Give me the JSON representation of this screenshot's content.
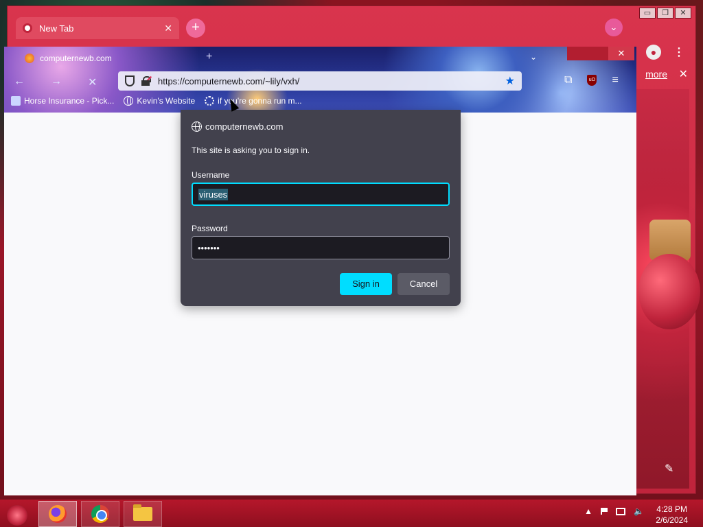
{
  "chrome": {
    "tab_title": "New Tab",
    "link_more": "more"
  },
  "firefox": {
    "tab_title": "computernewb.com",
    "url": "https://computernewb.com/~lily/vxh/",
    "bookmarks": [
      {
        "label": "Horse Insurance - Pick..."
      },
      {
        "label": "Kevin's Website"
      },
      {
        "label": "if you're gonna run m..."
      }
    ]
  },
  "dialog": {
    "site": "computernewb.com",
    "message": "This site is asking you to sign in.",
    "username_label": "Username",
    "username_value": "viruses",
    "password_label": "Password",
    "password_masked": "•••••••",
    "signin_label": "Sign in",
    "cancel_label": "Cancel",
    "accent_color": "#00ddff"
  },
  "taskbar": {
    "time": "4:28 PM",
    "date": "2/6/2024"
  }
}
